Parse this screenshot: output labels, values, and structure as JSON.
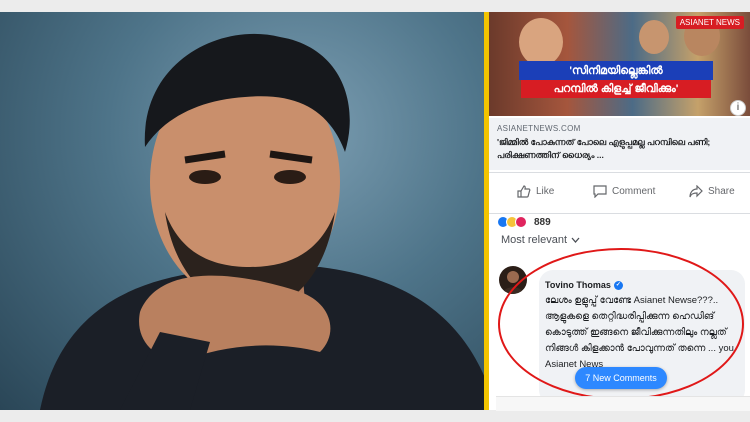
{
  "thumbnail": {
    "caption_line1": "'സിനിമയില്ലെങ്കിൽ",
    "caption_line2": "പറമ്പിൽ കിളച്ച് ജീവിക്കും'",
    "logo_text": "ASIANET NEWS"
  },
  "link_preview": {
    "source": "ASIANETNEWS.COM",
    "headline": "'ജിമ്മിൽ പോകുന്നത് പോലെ എളുപ്പമല്ല പറമ്പിലെ പണി; പരിക്ഷണത്തിന് ധൈര്യം ..."
  },
  "actions": {
    "like": "Like",
    "comment": "Comment",
    "share": "Share"
  },
  "reactions": {
    "count": "889",
    "colors": [
      "#1877f2",
      "#f5c33b",
      "#e0245e"
    ]
  },
  "sort_label": "Most relevant",
  "comment": {
    "author": "Tovino Thomas",
    "text": "ലേശം ഉളുപ്പ് വേണ്ടേ Asianet Newse???.. ആളുകളെ തെറ്റിദ്ധരിപ്പിക്കുന്ന ഹെഡിങ് കൊടുത്ത് ഇങ്ങനെ ജീവിക്കുന്നതിലും നല്ലത് നിങ്ങൾ കിളക്കാൻ പോവുന്നത് തന്നെ ... you Asianet News"
  },
  "new_comments_label": "7 New Comments"
}
